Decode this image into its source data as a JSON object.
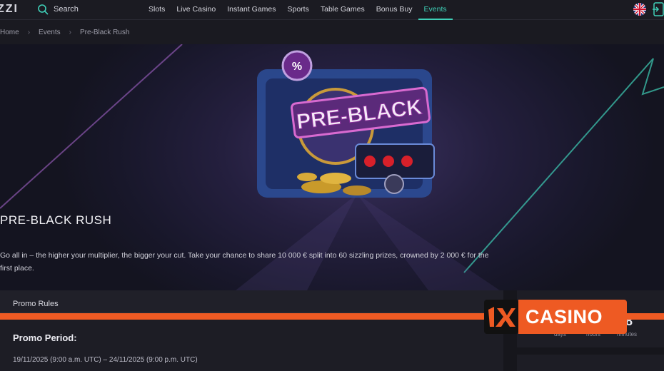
{
  "nav": {
    "logo": "ZZI",
    "search_label": "Search",
    "links": [
      "Slots",
      "Live Casino",
      "Instant Games",
      "Sports",
      "Table Games",
      "Bonus Buy",
      "Events"
    ],
    "active": "Events"
  },
  "breadcrumb": [
    "Home",
    "Events",
    "Pre-Black Rush"
  ],
  "hero": {
    "art_text": "PRE-BLACK",
    "title": "PRE-BLACK RUSH",
    "description": "Go all in – the higher your multiplier, the bigger your cut. Take your chance to share 10 000 € split into 60 sizzling prizes, crowned by 2 000 € for the first place."
  },
  "rules": {
    "header": "Promo Rules",
    "period_title": "Promo Period:",
    "period_dates": "19/11/2025 (9:00 a.m. UTC) – 24/11/2025 (9:00 p.m. UTC)"
  },
  "timer": {
    "visible_digit": "8",
    "labels": [
      "days",
      "hours",
      "minutes"
    ]
  },
  "overlay_badge": {
    "logo_text": "1x",
    "label": "CASINO"
  },
  "colors": {
    "accent": "#3fd0b8",
    "brand_orange": "#ee5a23",
    "background": "#16161c"
  },
  "icons": {
    "search": "search-icon",
    "chevron": "chevron-right-icon",
    "flag": "uk-flag-icon",
    "login": "login-icon"
  }
}
